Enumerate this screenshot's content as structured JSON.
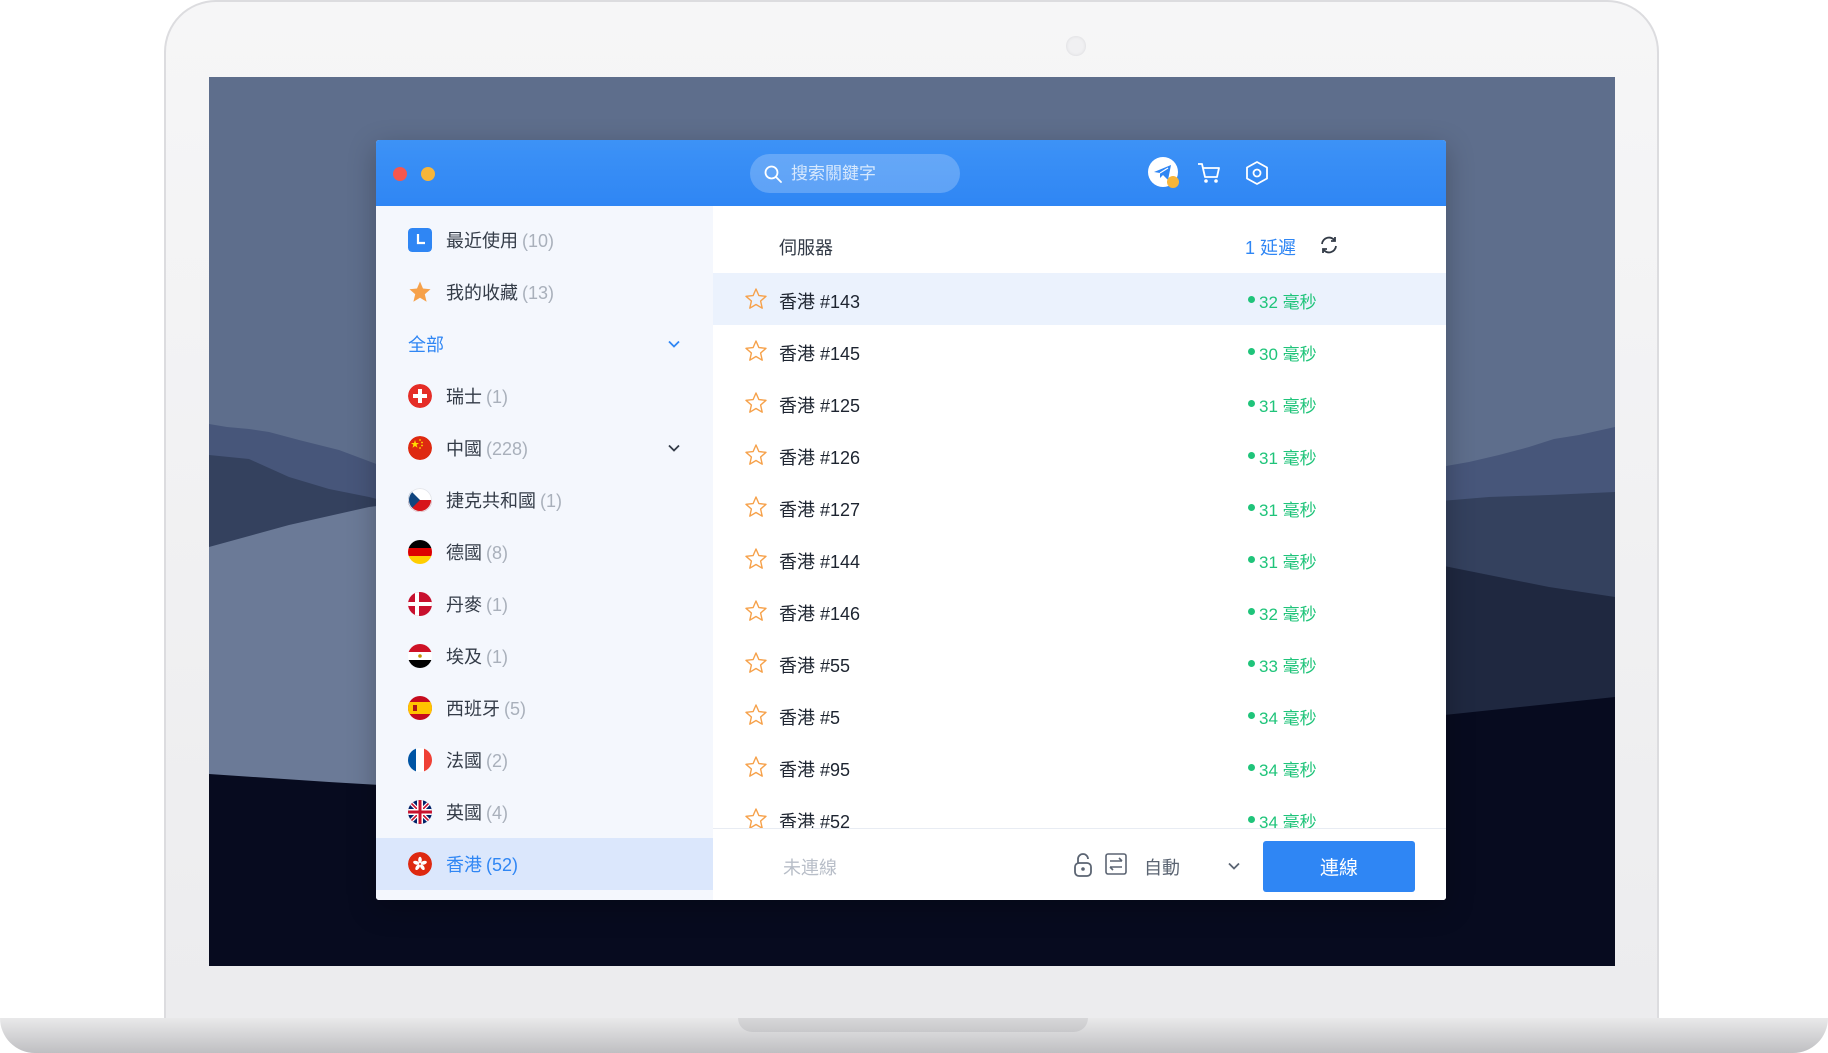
{
  "search": {
    "placeholder": "搜索關鍵字"
  },
  "colors": {
    "accent": "#2f86f4",
    "ping": "#1fc47a",
    "star": "#f6a14a",
    "traffic_red": "#f5574e",
    "traffic_yellow": "#f6b53a"
  },
  "titlebar": {
    "icons": [
      "telegram-icon",
      "cart-icon",
      "settings-icon"
    ]
  },
  "sidebar": {
    "recent": {
      "label": "最近使用",
      "count": "(10)"
    },
    "favorites": {
      "label": "我的收藏",
      "count": "(13)"
    },
    "all_label": "全部",
    "countries": [
      {
        "label": "瑞士",
        "count": "(1)"
      },
      {
        "label": "中國",
        "count": "(228)"
      },
      {
        "label": "捷克共和國",
        "count": "(1)"
      },
      {
        "label": "德國",
        "count": "(8)"
      },
      {
        "label": "丹麥",
        "count": "(1)"
      },
      {
        "label": "埃及",
        "count": "(1)"
      },
      {
        "label": "西班牙",
        "count": "(5)"
      },
      {
        "label": "法國",
        "count": "(2)"
      },
      {
        "label": "英國",
        "count": "(4)"
      },
      {
        "label": "香港",
        "count": "(52)"
      }
    ]
  },
  "main": {
    "header": {
      "server": "伺服器",
      "latency": "1 延遲"
    },
    "servers": [
      {
        "name": "香港 #143",
        "ping": "32 毫秒"
      },
      {
        "name": "香港 #145",
        "ping": "30 毫秒"
      },
      {
        "name": "香港 #125",
        "ping": "31 毫秒"
      },
      {
        "name": "香港 #126",
        "ping": "31 毫秒"
      },
      {
        "name": "香港 #127",
        "ping": "31 毫秒"
      },
      {
        "name": "香港 #144",
        "ping": "31 毫秒"
      },
      {
        "name": "香港 #146",
        "ping": "32 毫秒"
      },
      {
        "name": "香港 #55",
        "ping": "33 毫秒"
      },
      {
        "name": "香港 #5",
        "ping": "34 毫秒"
      },
      {
        "name": "香港 #95",
        "ping": "34 毫秒"
      },
      {
        "name": "香港 #52",
        "ping": "34 毫秒"
      }
    ],
    "footer": {
      "status": "未連線",
      "protocol": "自動",
      "connect": "連線"
    }
  }
}
